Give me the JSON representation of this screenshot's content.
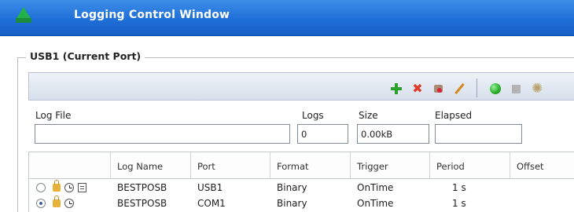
{
  "window": {
    "title": "Logging Control Window"
  },
  "group": {
    "label": "USB1 (Current Port)"
  },
  "toolbar": {
    "icons": [
      "add-icon",
      "remove-icon",
      "clear-icon",
      "edit-icon",
      "start-icon",
      "stop-icon",
      "settings-icon"
    ],
    "remove_glyph": "✖",
    "settings_glyph": "✺"
  },
  "fields": {
    "log_file": {
      "label": "Log File",
      "value": ""
    },
    "logs": {
      "label": "Logs",
      "value": "0"
    },
    "size": {
      "label": "Size",
      "value": "0.00kB"
    },
    "elapsed": {
      "label": "Elapsed",
      "value": ""
    }
  },
  "table": {
    "columns": [
      "Log Name",
      "Port",
      "Format",
      "Trigger",
      "Period",
      "Offset"
    ],
    "rows": [
      {
        "selected": false,
        "log_name": "BESTPOSB",
        "port": "USB1",
        "format": "Binary",
        "trigger": "OnTime",
        "period": "1 s",
        "offset": ""
      },
      {
        "selected": true,
        "log_name": "BESTPOSB",
        "port": "COM1",
        "format": "Binary",
        "trigger": "OnTime",
        "period": "1 s",
        "offset": ""
      }
    ]
  },
  "colors": {
    "titlebar": "#1f6fd8",
    "accent_green": "#2ca02c",
    "accent_red": "#e03a2a"
  }
}
